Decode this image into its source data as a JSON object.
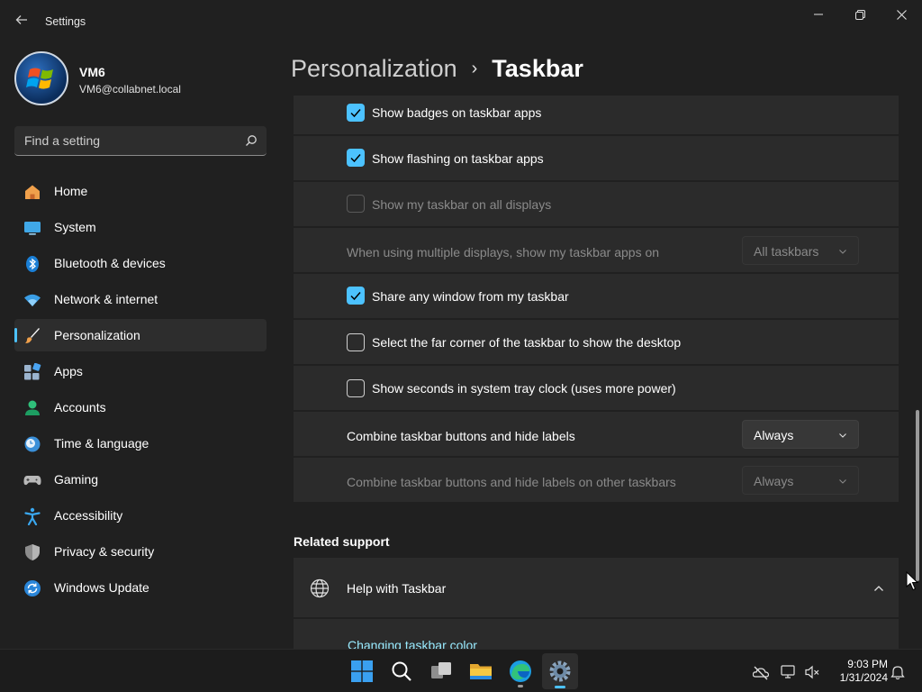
{
  "window": {
    "title": "Settings"
  },
  "profile": {
    "name": "VM6",
    "email": "VM6@collabnet.local"
  },
  "search": {
    "placeholder": "Find a setting"
  },
  "sidebar": {
    "items": [
      {
        "label": "Home",
        "icon": "home-icon"
      },
      {
        "label": "System",
        "icon": "system-icon"
      },
      {
        "label": "Bluetooth & devices",
        "icon": "bluetooth-icon"
      },
      {
        "label": "Network & internet",
        "icon": "wifi-icon"
      },
      {
        "label": "Personalization",
        "icon": "brush-icon",
        "active": true
      },
      {
        "label": "Apps",
        "icon": "apps-icon"
      },
      {
        "label": "Accounts",
        "icon": "accounts-icon"
      },
      {
        "label": "Time & language",
        "icon": "clock-globe-icon"
      },
      {
        "label": "Gaming",
        "icon": "gamepad-icon"
      },
      {
        "label": "Accessibility",
        "icon": "accessibility-icon"
      },
      {
        "label": "Privacy & security",
        "icon": "shield-icon"
      },
      {
        "label": "Windows Update",
        "icon": "update-icon"
      }
    ]
  },
  "breadcrumb": {
    "parent": "Personalization",
    "separator": "›",
    "current": "Taskbar"
  },
  "settings": {
    "badges": {
      "label": "Show badges on taskbar apps",
      "checked": true
    },
    "flashing": {
      "label": "Show flashing on taskbar apps",
      "checked": true
    },
    "all_displays": {
      "label": "Show my taskbar on all displays",
      "checked": false,
      "disabled": true
    },
    "multi_display": {
      "label": "When using multiple displays, show my taskbar apps on",
      "value": "All taskbars",
      "disabled": true
    },
    "share_window": {
      "label": "Share any window from my taskbar",
      "checked": true
    },
    "far_corner": {
      "label": "Select the far corner of the taskbar to show the desktop",
      "checked": false
    },
    "seconds": {
      "label": "Show seconds in system tray clock (uses more power)",
      "checked": false
    },
    "combine": {
      "label": "Combine taskbar buttons and hide labels",
      "value": "Always"
    },
    "combine_other": {
      "label": "Combine taskbar buttons and hide labels on other taskbars",
      "value": "Always",
      "disabled": true
    }
  },
  "related": {
    "title": "Related support",
    "help_label": "Help with Taskbar",
    "link": "Changing taskbar color"
  },
  "taskbar": {
    "apps": [
      "start-icon",
      "search-icon",
      "task-view-icon",
      "file-explorer-icon",
      "edge-icon",
      "settings-icon"
    ],
    "time": "9:03 PM",
    "date": "1/31/2024"
  },
  "colors": {
    "accent": "#4cc2ff",
    "background": "#202020",
    "card": "#2b2b2b",
    "link": "#99ebff"
  }
}
